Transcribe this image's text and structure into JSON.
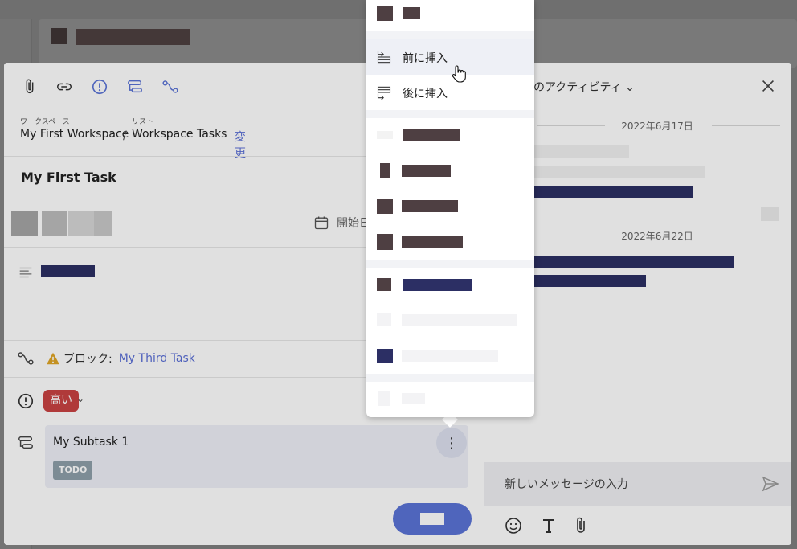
{
  "breadcrumb": {
    "workspace_caption": "ワークスペース",
    "workspace_name": "My First Workspace",
    "separator": "/",
    "list_caption": "リスト",
    "list_name": "Workspace Tasks",
    "change_label": "変更"
  },
  "task": {
    "title": "My First Task",
    "start_date_label": "開始日"
  },
  "blocking": {
    "label": "ブロック:",
    "task_link": "My Third Task"
  },
  "priority": {
    "value": "高い",
    "color": "#c94242"
  },
  "subtask": {
    "name": "My Subtask 1",
    "status": "TODO",
    "menu_icon": "⋮"
  },
  "activity": {
    "title": "のアクティビティ",
    "dates": [
      "2022年6月17日",
      "2022年6月22日"
    ],
    "message_placeholder": "新しいメッセージの入力"
  },
  "context_menu": {
    "insert_before": "前に挿入",
    "insert_after": "後に挿入"
  },
  "colors": {
    "accent": "#5a73d6",
    "link": "#5a6fd6",
    "redacted_dark": "#4e3f42",
    "redacted_navy": "#2c2f64"
  }
}
